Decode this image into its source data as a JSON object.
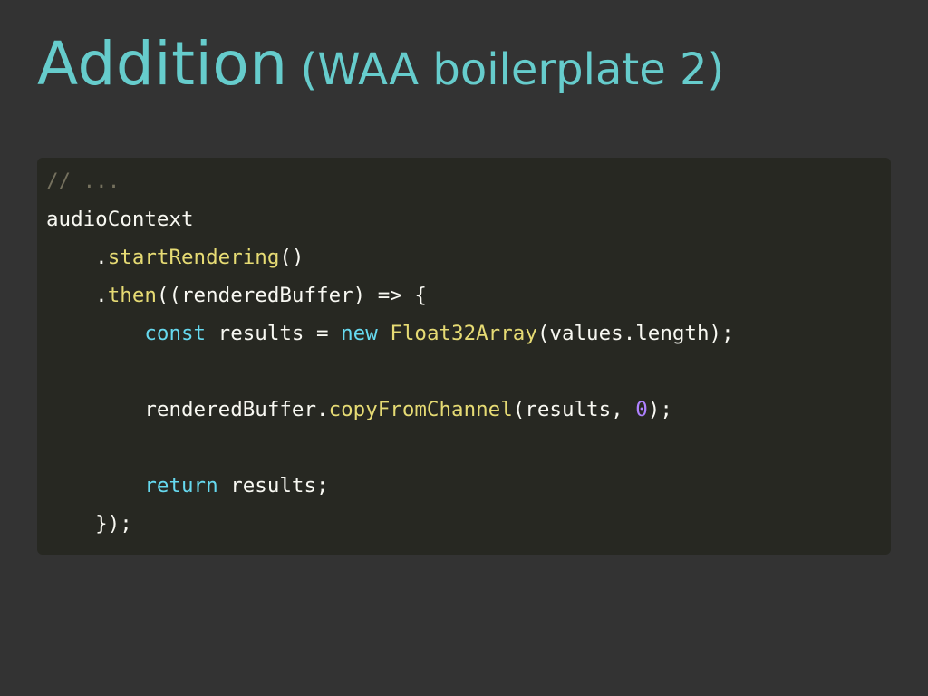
{
  "slide": {
    "title": "Addition",
    "subtitle": "(WAA boilerplate 2)"
  },
  "colors": {
    "background": "#333333",
    "title": "#66cccc",
    "code_background": "#272822",
    "code_text": "#f8f8f2",
    "code_comment": "#75715e",
    "code_function": "#e6db74",
    "code_keyword": "#66d9ef",
    "code_number": "#ae81ff"
  },
  "code": {
    "language": "javascript",
    "lines": [
      [
        {
          "t": "// ...",
          "k": "comment"
        }
      ],
      [
        {
          "t": "audioContext",
          "k": "plain"
        }
      ],
      [
        {
          "t": "    .",
          "k": "plain"
        },
        {
          "t": "startRendering",
          "k": "func"
        },
        {
          "t": "()",
          "k": "plain"
        }
      ],
      [
        {
          "t": "    .",
          "k": "plain"
        },
        {
          "t": "then",
          "k": "func"
        },
        {
          "t": "((renderedBuffer) => {",
          "k": "plain"
        }
      ],
      [
        {
          "t": "        ",
          "k": "plain"
        },
        {
          "t": "const",
          "k": "keyword"
        },
        {
          "t": " results = ",
          "k": "plain"
        },
        {
          "t": "new",
          "k": "keyword"
        },
        {
          "t": " ",
          "k": "plain"
        },
        {
          "t": "Float32Array",
          "k": "func"
        },
        {
          "t": "(values.length);",
          "k": "plain"
        }
      ],
      [],
      [
        {
          "t": "        renderedBuffer.",
          "k": "plain"
        },
        {
          "t": "copyFromChannel",
          "k": "func"
        },
        {
          "t": "(results, ",
          "k": "plain"
        },
        {
          "t": "0",
          "k": "number"
        },
        {
          "t": ");",
          "k": "plain"
        }
      ],
      [],
      [
        {
          "t": "        ",
          "k": "plain"
        },
        {
          "t": "return",
          "k": "keyword"
        },
        {
          "t": " results;",
          "k": "plain"
        }
      ],
      [
        {
          "t": "    });",
          "k": "plain"
        }
      ]
    ]
  }
}
